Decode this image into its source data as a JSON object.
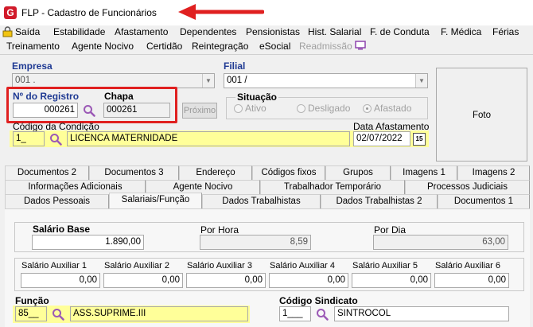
{
  "window": {
    "title": "FLP - Cadastro de Funcionários",
    "logo_letter": "G"
  },
  "menu": {
    "row1": [
      "Saída",
      "Estabilidade",
      "Afastamento",
      "Dependentes",
      "Pensionistas",
      "Hist. Salarial",
      "F. de Conduta",
      "F. Médica",
      "Férias"
    ],
    "row2": [
      "Treinamento",
      "Agente Nocivo",
      "Certidão",
      "Reintegração",
      "eSocial"
    ],
    "row2_disabled": "Readmissão"
  },
  "form": {
    "empresa_label": "Empresa",
    "empresa_value": "001 .",
    "filial_label": "Filial",
    "filial_value": "001 /",
    "registro_label": "Nº do Registro",
    "registro_value": "000261",
    "chapa_label": "Chapa",
    "chapa_value": "000261",
    "proximo_label": "Próximo",
    "situacao_label": "Situação",
    "situacao_options": [
      "Ativo",
      "Desligado",
      "Afastado"
    ],
    "situacao_selected": "Afastado",
    "codigo_condicao_label": "Código da Condição",
    "codigo_condicao_value": "1_",
    "condicao_desc": "LICENCA MATERNIDADE",
    "data_afastamento_label": "Data Afastamento",
    "data_afastamento_value": "02/07/2022",
    "calendar_glyph": "15",
    "foto_label": "Foto"
  },
  "tabs": {
    "row1": [
      "Documentos 2",
      "Documentos 3",
      "Endereço",
      "Códigos fixos",
      "Grupos",
      "Imagens 1",
      "Imagens 2"
    ],
    "row2": [
      "Informações Adicionais",
      "Agente Nocivo",
      "Trabalhador Temporário",
      "Processos Judiciais"
    ],
    "row3": [
      "Dados Pessoais",
      "Salariais/Função",
      "Dados Trabalhistas",
      "Dados Trabalhistas 2",
      "Documentos 1"
    ],
    "active": "Salariais/Função"
  },
  "salariais": {
    "salario_base_label": "Salário Base",
    "salario_base_value": "1.890,00",
    "por_hora_label": "Por Hora",
    "por_hora_value": "8,59",
    "por_dia_label": "Por Dia",
    "por_dia_value": "63,00",
    "auxiliares": [
      {
        "label": "Salário Auxiliar 1",
        "value": "0,00"
      },
      {
        "label": "Salário Auxiliar 2",
        "value": "0,00"
      },
      {
        "label": "Salário Auxiliar 3",
        "value": "0,00"
      },
      {
        "label": "Salário Auxiliar 4",
        "value": "0,00"
      },
      {
        "label": "Salário Auxiliar 5",
        "value": "0,00"
      },
      {
        "label": "Salário Auxiliar 6",
        "value": "0,00"
      }
    ],
    "funcao_label": "Função",
    "funcao_code": "85__",
    "funcao_desc": "ASS.SUPRIME.III",
    "sindicato_label": "Código Sindicato",
    "sindicato_code": "1___",
    "sindicato_desc": "SINTROCOL"
  },
  "colors": {
    "highlight": "#e02020",
    "required_yellow": "#ffff99",
    "blue_label": "#1f3a93",
    "search_icon": "#9b59b6"
  }
}
